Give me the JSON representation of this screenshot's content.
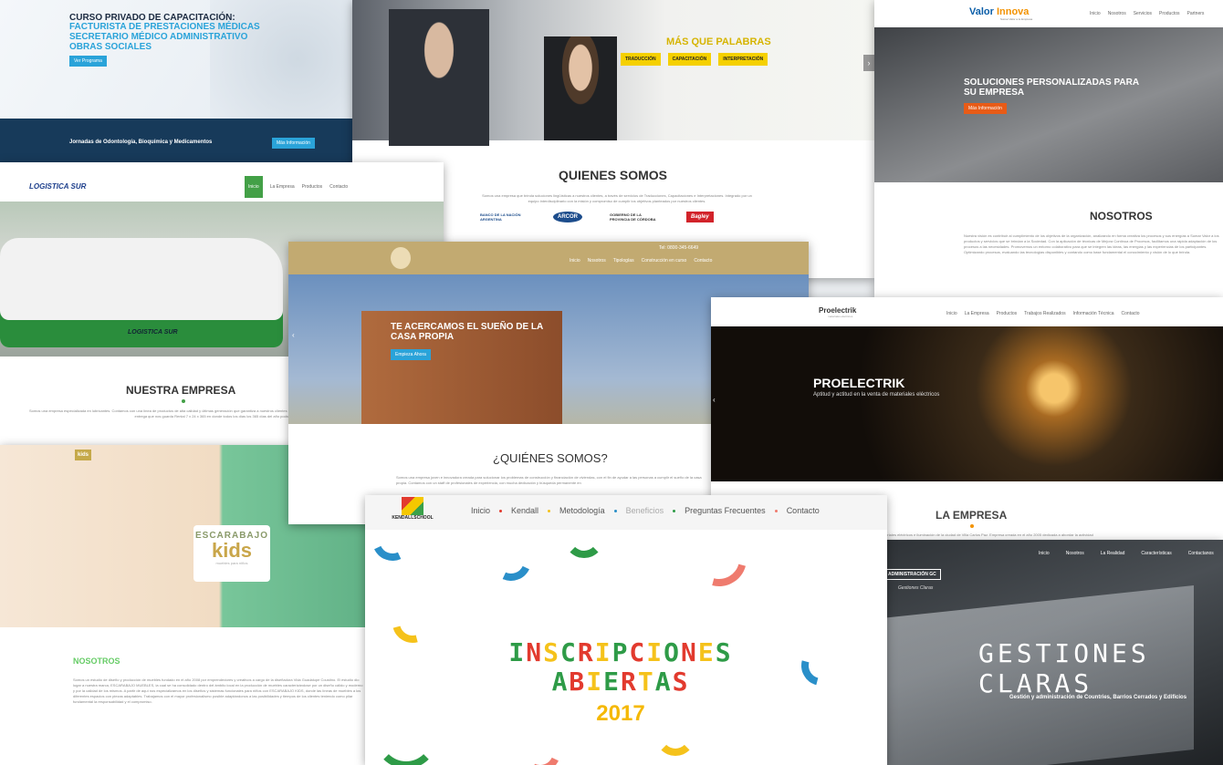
{
  "card1": {
    "title_line1": "CURSO PRIVADO DE CAPACITACIÓN:",
    "title_line2": "FACTURISTA DE PRESTACIONES MÉDICAS",
    "title_line3": "SECRETARIO MÉDICO ADMINISTRATIVO",
    "title_line4": "OBRAS SOCIALES",
    "button": "Ver Programa",
    "bar_text": "Jornadas de Odontología, Bioquímica y Medicamentos",
    "bar_button": "Más Información"
  },
  "card2": {
    "hero_title": "MÁS QUE PALABRAS",
    "tags": [
      "TRADUCCIÓN",
      "CAPACITACIÓN",
      "INTERPRETACIÓN"
    ],
    "section_title": "QUIENES SOMOS",
    "paragraph": "Somos una empresa que brinda soluciones lingüísticas a nuestros clientes, a través de servicios de Traducciones, Capacitaciones e Interpretaciones. Integrado por un equipo interdisciplinario con la misión y compromiso de cumplir los objetivos planteados por nuestros clientes.",
    "logos": [
      "BANCO DE LA NACIÓN ARGENTINA",
      "ARCOR",
      "GOBIERNO DE LA PROVINCIA DE CÓRDOBA",
      "Bagley"
    ]
  },
  "card3": {
    "brand_a": "Valor ",
    "brand_b": "Innova",
    "brand_sub": "Sumar Valor a tu Empresa",
    "nav": [
      "Inicio",
      "Nosotros",
      "Servicios",
      "Productos",
      "Partners"
    ],
    "hero_title": "SOLUCIONES PERSONALIZADAS PARA SU EMPRESA",
    "hero_button": "Más Información",
    "section_title": "NOSOTROS",
    "paragraph": "Nuestra visión es contribuir al cumplimiento de los objetivos de la organización, analizando en forma creativa los procesos y sus energías a Sumar Valor a los productos y servicios que se brindan a la Sociedad. Con la aplicación de técnicas de Mejora Continua de Procesos, facilitamos una rápida adaptación de los procesos a las necesidades. Promovemos un entorno colaborativo para que se integren las ideas, las energías y las experiencias de los participantes. Optimizando procesos, evaluando las tecnologías disponibles y contando como base fundamental el conocimiento y visión de lo que brinda."
  },
  "card4": {
    "brand": "LOGISTICA SUR",
    "nav": [
      "Inicio",
      "La Empresa",
      "Productos",
      "Contacto"
    ],
    "truck_text": "LOGISTICA SUR",
    "section_title": "NUESTRA EMPRESA",
    "paragraph": "Somos una empresa especializada en lubricantes. Contamos con una línea de productos de alta calidad y últimas generación que garantiza a nuestros clientes sus necesidades. Ofrecemos a nuestros clientes un servicio de asesoramiento y entrega que nos guarda Rental 7 x 24 x 365 en donde todos los días los 365 días del año podrá contactarnos."
  },
  "card5": {
    "logo_small": "kids",
    "panel_title": "ESCARABAJO",
    "panel_kids": "kids",
    "panel_sub": "muebles para niños",
    "section_title": "NOSOTROS",
    "paragraph": "Somos un estudio de diseño y producción de muebles fundado en el año 2008 por emprendedores y creativos a cargo de la diseñadora Vida Guadalupe Coustino. El estudio dio lugar a nuestra marca, ESCARABAJO MUEBLES, la cual se ha consolidado dentro del ámbito local en la producción de muebles caracterizándose por un diseño cálido y moderno y por la calidad de los mismos. A partir de aquí nos especializamos en los diseños y sistemas funcionales para niños con ESCARABAJO KIDS, donde las líneas de muebles a los diferentes espacios con piezas adaptables. Trabajamos con el mayor profesionalismo posible adaptándonos a las posibilidades y tiempos de los clientes teniendo como pilar fundamental la responsabilidad y el compromiso."
  },
  "card6": {
    "phone": "Tel: 0800-345-6649",
    "nav": [
      "Inicio",
      "Nosotros",
      "Tipologías",
      "Construcción en curso",
      "Contacto"
    ],
    "hero_title": "TE ACERCAMOS EL SUEÑO DE LA CASA PROPIA",
    "hero_button": "Empieza Ahora",
    "section_title": "¿QUIÉNES SOMOS?",
    "paragraph": "Somos una empresa joven e innovadora creada para solucionar los problemas de construcción y financiación de viviendas, con el fin de ayudar a las personas a cumplir el sueño de la casa propia. Contamos con un staff de profesionales de experiencia, con mucha dedicación y búsqueda permanente en"
  },
  "card7": {
    "brand": "Proelectrik",
    "brand_sub": "materiales eléctricos",
    "nav": [
      "Inicio",
      "La Empresa",
      "Productos",
      "Trabajos Realizados",
      "Información Técnica",
      "Contacto"
    ],
    "hero_title": "PROELECTRIK",
    "hero_sub": "Aptitud y actitud en la venta de materiales eléctricos",
    "section_title": "LA EMPRESA",
    "paragraph": "...materiales eléctricos e iluminación de la ciudad de Villa Carlos Paz. Empresa creada en el año 2005 dedicada a abordar la actividad"
  },
  "card8": {
    "logo": "ADMINISTRACIÓN GC",
    "logo_sub": "Gestiones Claras",
    "nav": [
      "Inicio",
      "Nosotros",
      "La Realidad",
      "Características",
      "Contactanos"
    ],
    "title": "GESTIONES CLARAS",
    "subtitle": "Gestión y administración de Countries, Barrios Cerrados y Edificios"
  },
  "card9": {
    "brand": "KENDALLSCHOOL",
    "nav": [
      "Inicio",
      "Kendall",
      "Metodología",
      "Beneficios",
      "Preguntas Frecuentes",
      "Contacto"
    ],
    "line1": "INSCRIPCIONES",
    "line2": "ABIERTAS",
    "year": "2017",
    "colors": {
      "green": "#2e9b47",
      "red": "#e23a2e",
      "yellow": "#f5c21b",
      "blue": "#2a8fc9",
      "salmon": "#ef7b6e"
    }
  }
}
